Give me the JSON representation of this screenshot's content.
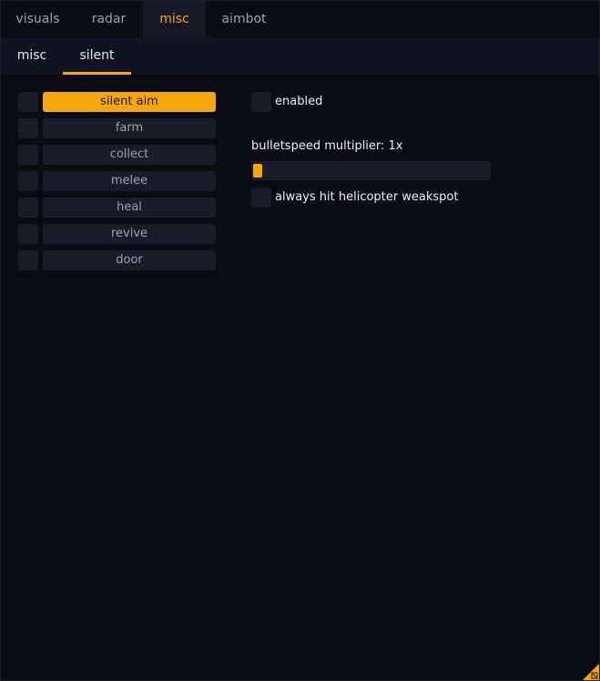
{
  "colors": {
    "accent": "#f5a70f",
    "background": "#0b0c13",
    "subtab_bar": "#121320",
    "control": "#1a1c2a",
    "muted_text": "#9ea0ab"
  },
  "top_tabs": [
    {
      "label": "visuals",
      "active": false
    },
    {
      "label": "radar",
      "active": false
    },
    {
      "label": "misc",
      "active": true
    },
    {
      "label": "aimbot",
      "active": false
    }
  ],
  "sub_tabs": [
    {
      "label": "misc",
      "active": false
    },
    {
      "label": "silent",
      "active": true
    }
  ],
  "list": [
    {
      "label": "silent aim",
      "active": true
    },
    {
      "label": "farm",
      "active": false
    },
    {
      "label": "collect",
      "active": false
    },
    {
      "label": "melee",
      "active": false
    },
    {
      "label": "heal",
      "active": false
    },
    {
      "label": "revive",
      "active": false
    },
    {
      "label": "door",
      "active": false
    }
  ],
  "settings": {
    "enabled_label": "enabled",
    "enabled_checked": false,
    "slider_label": "bulletspeed multiplier: 1x",
    "slider_fraction": 0.0,
    "weakspot_label": "always hit helicopter weakspot",
    "weakspot_checked": false
  }
}
